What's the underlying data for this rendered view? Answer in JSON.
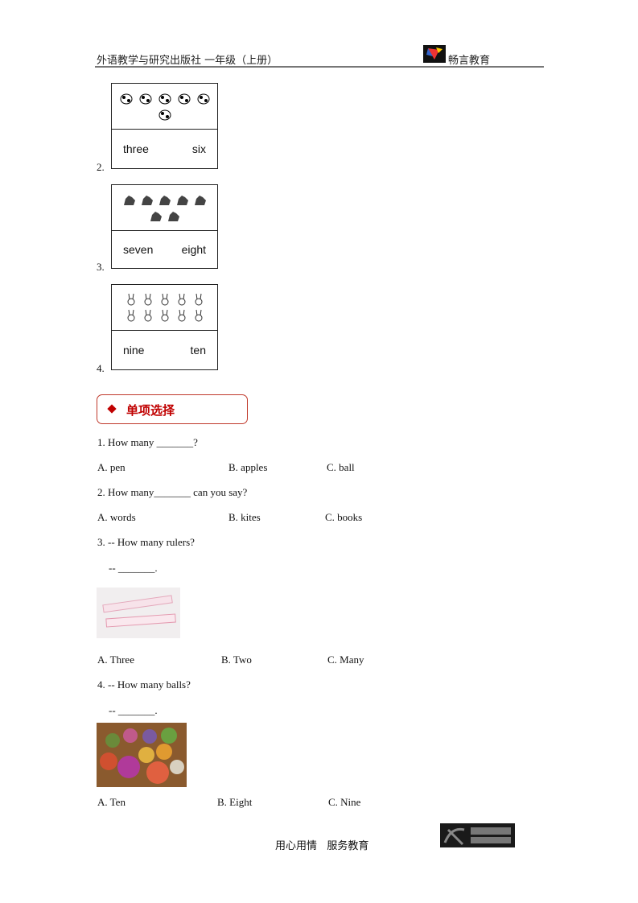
{
  "header": {
    "publisher": "外语教学与研究出版社 一年级（上册）",
    "brand": "畅言教育"
  },
  "cards": [
    {
      "number": "2.",
      "words": [
        "three",
        "six"
      ],
      "picture": "cow",
      "count": 6
    },
    {
      "number": "3.",
      "words": [
        "seven",
        "eight"
      ],
      "picture": "dinosaur",
      "count": 7
    },
    {
      "number": "4.",
      "words": [
        "nine",
        "ten"
      ],
      "picture": "rabbit",
      "count": 10
    }
  ],
  "section": {
    "title": "单项选择",
    "accent": "#c00000"
  },
  "questions": [
    {
      "stem": "1. How many _______?",
      "options": [
        "A. pen",
        "B. apples",
        "C. ball"
      ]
    },
    {
      "stem": "2. How many_______ can you say?",
      "options": [
        "A. words",
        "B. kites",
        "C. books"
      ]
    },
    {
      "stem": "3. -- How many rulers?",
      "answer": "-- _______.",
      "image": "rulers-photo",
      "options": [
        "A. Three",
        "B. Two",
        "C. Many"
      ]
    },
    {
      "stem": "4. -- How many balls?",
      "answer": "-- _______.",
      "image": "balls-photo",
      "options": [
        "A. Ten",
        "B. Eight",
        "C. Nine"
      ]
    }
  ],
  "footer": {
    "slogan": "用心用情   服务教育",
    "logo_text": "科大讯飞 IFLYTEK"
  }
}
